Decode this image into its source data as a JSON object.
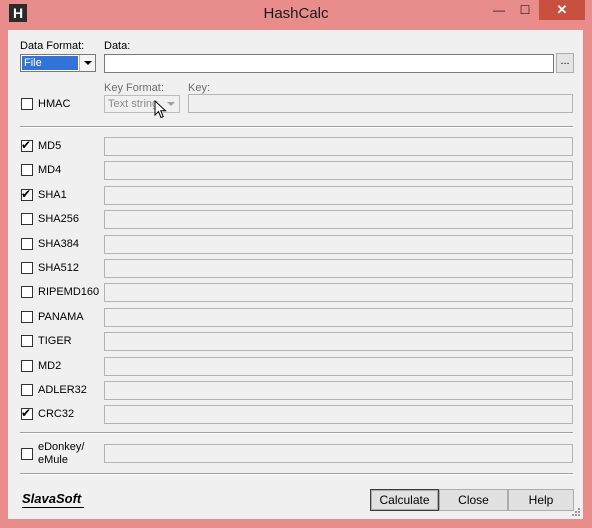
{
  "window": {
    "title": "HashCalc",
    "icon_letter": "H",
    "minimize_glyph": "—",
    "maximize_glyph": "☐",
    "close_glyph": "✕"
  },
  "data_format": {
    "label": "Data Format:",
    "value": "File"
  },
  "data": {
    "label": "Data:",
    "value": "",
    "browse_label": "..."
  },
  "hmac": {
    "label": "HMAC",
    "checked": false
  },
  "key_format": {
    "label": "Key Format:",
    "value": "Text string"
  },
  "key": {
    "label": "Key:",
    "value": ""
  },
  "hashes": [
    {
      "label": "MD5",
      "checked": true,
      "value": ""
    },
    {
      "label": "MD4",
      "checked": false,
      "value": ""
    },
    {
      "label": "SHA1",
      "checked": true,
      "value": ""
    },
    {
      "label": "SHA256",
      "checked": false,
      "value": ""
    },
    {
      "label": "SHA384",
      "checked": false,
      "value": ""
    },
    {
      "label": "SHA512",
      "checked": false,
      "value": ""
    },
    {
      "label": "RIPEMD160",
      "checked": false,
      "value": ""
    },
    {
      "label": "PANAMA",
      "checked": false,
      "value": ""
    },
    {
      "label": "TIGER",
      "checked": false,
      "value": ""
    },
    {
      "label": "MD2",
      "checked": false,
      "value": ""
    },
    {
      "label": "ADLER32",
      "checked": false,
      "value": ""
    },
    {
      "label": "CRC32",
      "checked": true,
      "value": ""
    }
  ],
  "edonkey": {
    "label_line1": "eDonkey/",
    "label_line2": "eMule",
    "checked": false,
    "value": ""
  },
  "buttons": {
    "calculate": "Calculate",
    "close": "Close",
    "help": "Help"
  },
  "logo": {
    "text": "SlavaSoft"
  },
  "check_glyph": "✔",
  "colors": {
    "frame": "#e88c8c",
    "close_button": "#c7503f",
    "selection": "#3372d6",
    "client": "#f0f0f0"
  }
}
